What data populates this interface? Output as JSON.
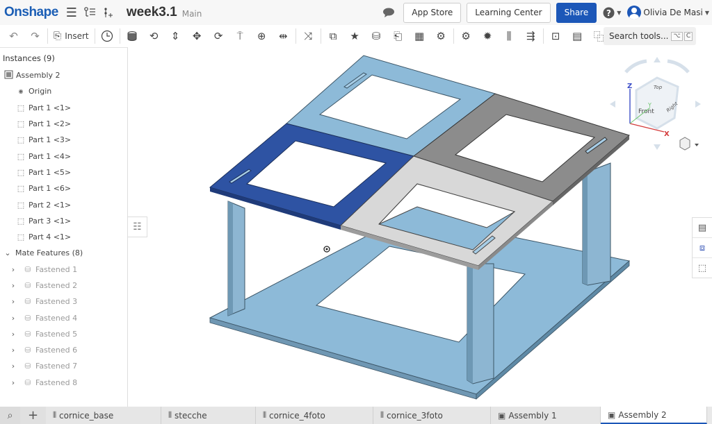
{
  "app": {
    "logo": "Onshape",
    "document_title": "week3.1",
    "branch": "Main"
  },
  "header": {
    "app_store": "App Store",
    "learning_center": "Learning Center",
    "share": "Share",
    "help_icon": "question-circle-icon",
    "user_name": "Olivia De Masi",
    "comment_icon": "chat-bubble-icon"
  },
  "toolbar": {
    "insert_label": "Insert",
    "search_placeholder": "Search tools...",
    "shortcut_keys": [
      "⌥",
      "C"
    ],
    "tools": [
      "undo",
      "redo",
      "insert",
      "history",
      "fasten-mate",
      "revolute-mate",
      "slider-mate",
      "planar-mate",
      "cylindrical-mate",
      "pin-slot-mate",
      "ball-mate",
      "parallel-mate",
      "tangent-mate",
      "group",
      "mate-connector",
      "replicate",
      "linear-pattern",
      "circular-pattern",
      "gear-relation",
      "rack-pinion-relation",
      "screw-relation",
      "linear-relation",
      "explode",
      "display-states",
      "insert-part"
    ]
  },
  "sidebar": {
    "header": "Instances (9)",
    "root": "Assembly 2",
    "items": [
      {
        "label": "Origin",
        "icon": "origin-icon"
      },
      {
        "label": "Part 1 <1>",
        "icon": "part-icon"
      },
      {
        "label": "Part 1 <2>",
        "icon": "part-icon"
      },
      {
        "label": "Part 1 <3>",
        "icon": "part-icon"
      },
      {
        "label": "Part 1 <4>",
        "icon": "part-icon"
      },
      {
        "label": "Part 1 <5>",
        "icon": "part-icon"
      },
      {
        "label": "Part 1 <6>",
        "icon": "part-icon"
      },
      {
        "label": "Part 2 <1>",
        "icon": "part-icon"
      },
      {
        "label": "Part 3 <1>",
        "icon": "part-icon"
      },
      {
        "label": "Part 4 <1>",
        "icon": "part-icon"
      }
    ],
    "mate_header": "Mate Features (8)",
    "mates": [
      "Fastened 1",
      "Fastened 2",
      "Fastened 3",
      "Fastened 4",
      "Fastened 5",
      "Fastened 6",
      "Fastened 7",
      "Fastened 8"
    ]
  },
  "view_cube": {
    "faces": [
      "Top",
      "Front",
      "Right"
    ],
    "axes": [
      "X",
      "Y",
      "Z"
    ]
  },
  "tabs": [
    {
      "label": "cornice_base",
      "type": "part-studio"
    },
    {
      "label": "stecche",
      "type": "part-studio"
    },
    {
      "label": "cornice_4foto",
      "type": "part-studio"
    },
    {
      "label": "cornice_3foto",
      "type": "part-studio"
    },
    {
      "label": "Assembly 1",
      "type": "assembly"
    },
    {
      "label": "Assembly 2",
      "type": "assembly",
      "active": true
    }
  ],
  "colors": {
    "brand": "#1b5eb5",
    "share": "#1c57b8",
    "part_light_blue": "#8dbad8",
    "part_dark_blue": "#2e53a3",
    "part_gray": "#8c8c8c",
    "part_light_gray": "#d8d8d8"
  }
}
